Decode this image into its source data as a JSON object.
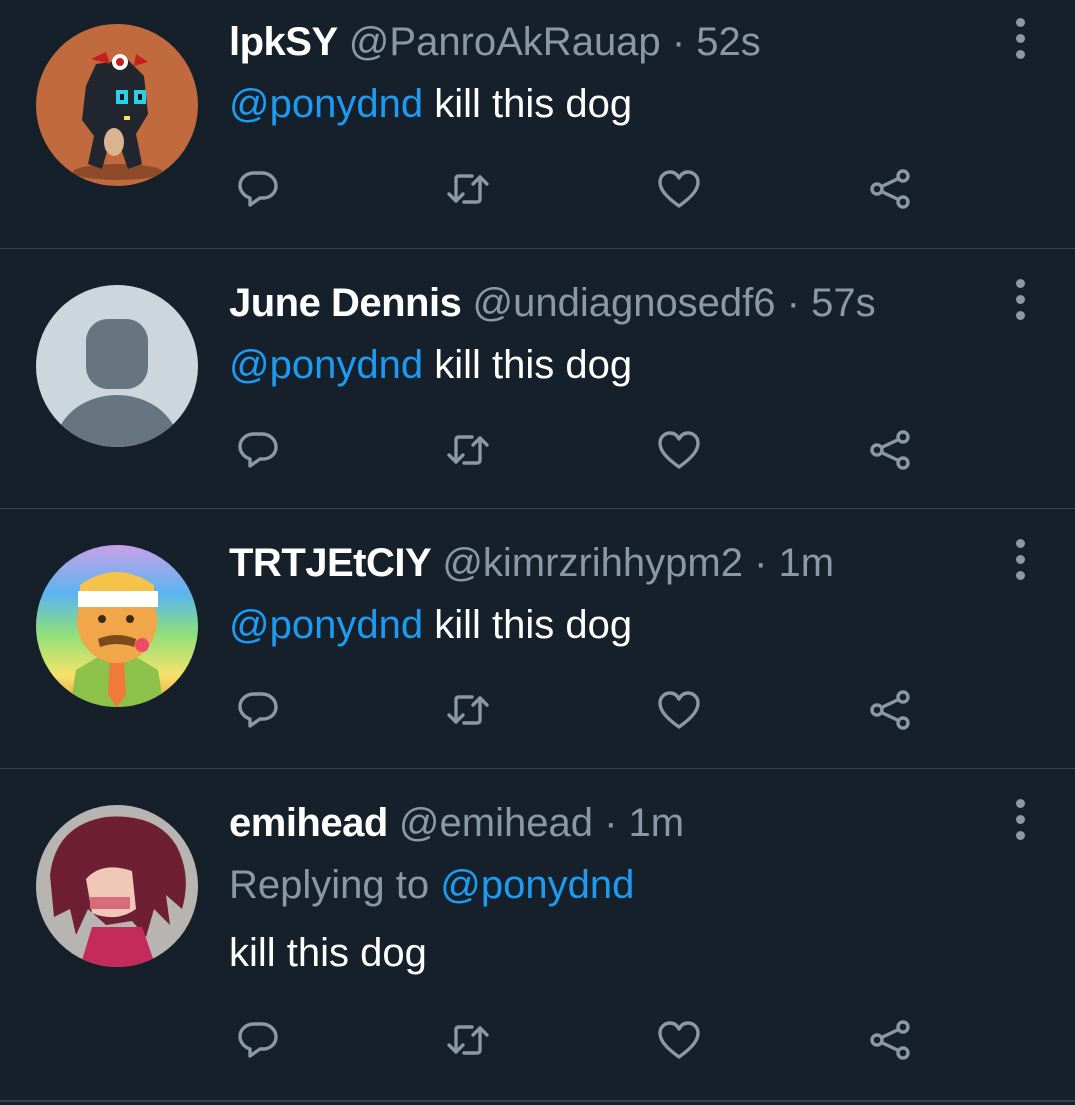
{
  "tweets": [
    {
      "name": "lpkSY",
      "handle": "@PanroAkRauap",
      "separator": "·",
      "time": "52s",
      "mention": "@ponydnd",
      "text": "kill this dog",
      "avatar_icon": "dragon-avatar"
    },
    {
      "name": "June Dennis",
      "handle": "@undiagnosedf6",
      "separator": "·",
      "time": "57s",
      "mention": "@ponydnd",
      "text": "kill this dog",
      "avatar_icon": "default-avatar"
    },
    {
      "name": "TRTJEtCIY",
      "handle": "@kimrzrihhypm2",
      "separator": "·",
      "time": "1m",
      "mention": "@ponydnd",
      "text": "kill this dog",
      "avatar_icon": "cartoon-man-avatar"
    },
    {
      "name": "emihead",
      "handle": "@emihead",
      "separator": "·",
      "time": "1m",
      "replying_prefix": "Replying to",
      "mention": "@ponydnd",
      "text": "kill this dog",
      "avatar_icon": "red-hair-avatar"
    }
  ],
  "colors": {
    "background": "#15202b",
    "divider": "#38444d",
    "secondary_text": "#8b98a5",
    "link": "#1d9bf0"
  },
  "icons": [
    "reply-icon",
    "retweet-icon",
    "like-icon",
    "share-icon",
    "more-options-icon"
  ]
}
